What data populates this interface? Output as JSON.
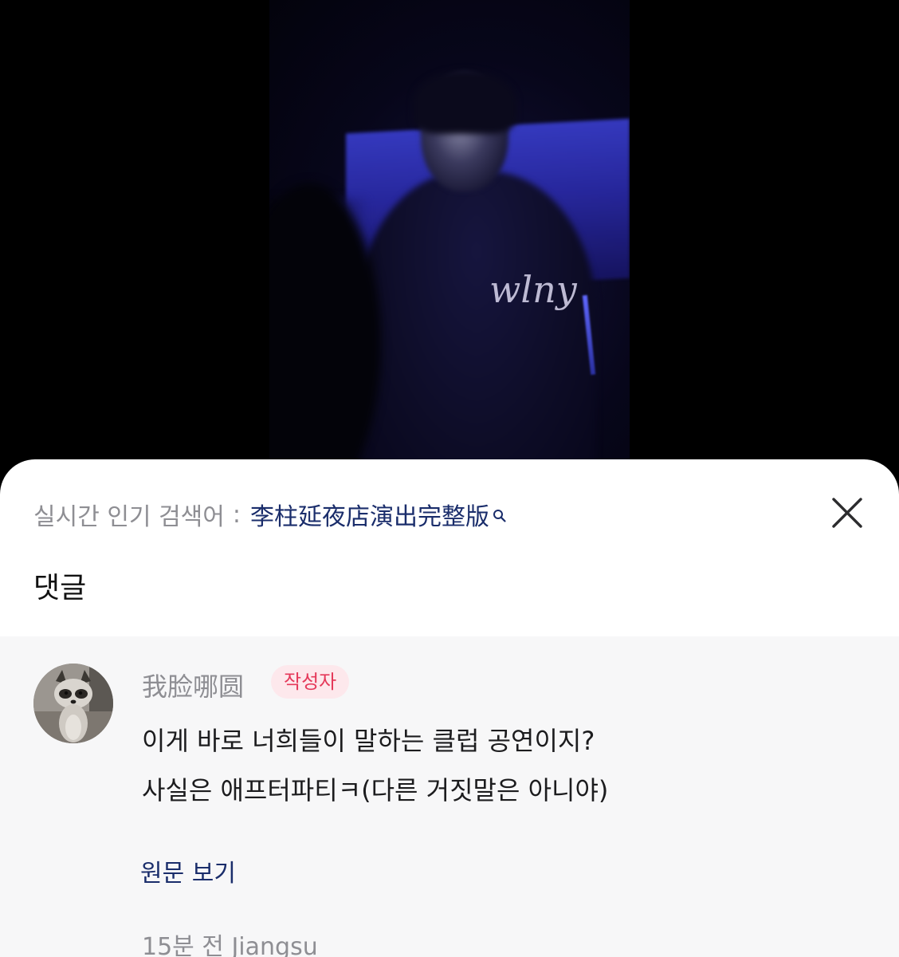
{
  "video": {
    "watermark": "wlny"
  },
  "trending": {
    "label": "실시간 인기 검색어",
    "separator": ":",
    "keyword": "李柱延夜店演出完整版",
    "icon": "search-icon"
  },
  "close": {
    "icon": "close-icon"
  },
  "sheet": {
    "title": "댓글"
  },
  "comment": {
    "author": "我脸哪圆",
    "badge": "작성자",
    "lines": [
      "이게 바로 너희들이 말하는 클럽 공연이지?",
      "사실은 애프터파티ㅋ(다른 거짓말은 아니야)"
    ],
    "view_original": "원문 보기",
    "meta": "15분 전 Jiangsu"
  },
  "colors": {
    "link": "#1a2d6b",
    "badge_text": "#e5395a",
    "badge_bg": "#fde8ec",
    "muted": "#8e8e93"
  }
}
